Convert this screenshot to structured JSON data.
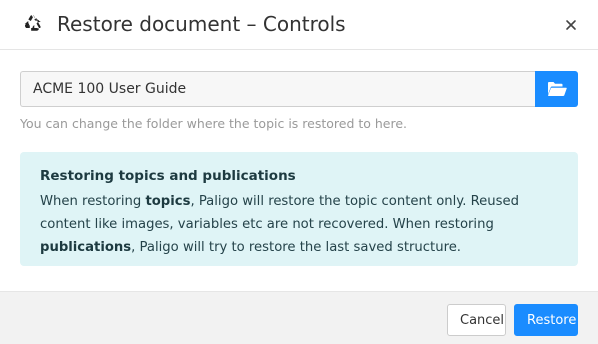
{
  "dialog": {
    "title": "Restore document – Controls",
    "close_label": "×"
  },
  "folder": {
    "value": "ACME 100 User Guide",
    "help_text": "You can change the folder where the topic is restored to here."
  },
  "info": {
    "title": "Restoring topics and publications",
    "text_part1": "When restoring ",
    "bold1": "topics",
    "text_part2": ", Paligo will restore the topic content only. Reused content like images, variables etc are not recovered. When restoring ",
    "bold2": "publications",
    "text_part3": ", Paligo will try to restore the last saved structure."
  },
  "footer": {
    "cancel_label": "Cancel",
    "restore_label": "Restore"
  },
  "icons": {
    "header": "recycle-icon",
    "close": "close-icon",
    "folder": "folder-open-icon"
  },
  "colors": {
    "primary": "#1a8cff",
    "info_bg": "#dff4f6"
  }
}
